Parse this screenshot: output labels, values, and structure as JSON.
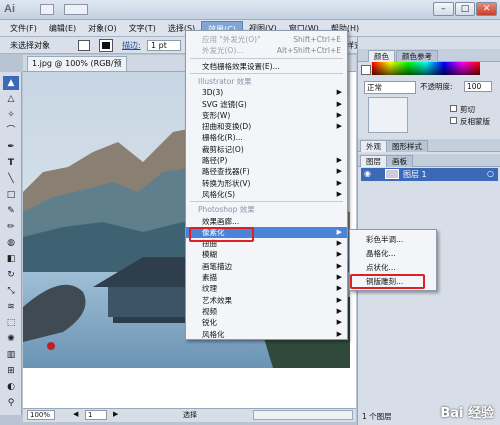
{
  "app": {
    "logo": "Ai",
    "window_controls": {
      "min": "–",
      "max": "□",
      "close": "✕"
    }
  },
  "menubar": {
    "items": [
      "文件(F)",
      "编辑(E)",
      "对象(O)",
      "文字(T)",
      "选择(S)",
      "效果(C)",
      "视图(V)",
      "窗口(W)",
      "帮助(H)"
    ],
    "active_index": 5
  },
  "control_bar": {
    "selection_label": "未选择对象",
    "stroke_label": "描边:",
    "stroke_value": "1 pt",
    "style_label": "样式"
  },
  "document": {
    "tab_title": "1.jpg @ 100% (RGB/预览)",
    "zoom": "100%",
    "page": "1",
    "status": "选择"
  },
  "effects_menu": {
    "items": [
      {
        "label": "应用 \"外发光(O)\"",
        "shortcut": "Shift+Ctrl+E",
        "disabled": true
      },
      {
        "label": "外发光(O)...",
        "shortcut": "Alt+Shift+Ctrl+E",
        "disabled": true
      },
      {
        "label": "文档栅格效果设置(E)...",
        "shortcut": ""
      },
      {
        "label": "Illustrator 效果",
        "header": true
      },
      {
        "label": "3D(3)",
        "submenu": true
      },
      {
        "label": "SVG 滤镜(G)",
        "submenu": true
      },
      {
        "label": "变形(W)",
        "submenu": true
      },
      {
        "label": "扭曲和变换(D)",
        "submenu": true
      },
      {
        "label": "栅格化(R)...",
        "submenu": false
      },
      {
        "label": "裁剪标记(O)",
        "submenu": false
      },
      {
        "label": "路径(P)",
        "submenu": true
      },
      {
        "label": "路径查找器(F)",
        "submenu": true
      },
      {
        "label": "转换为形状(V)",
        "submenu": true
      },
      {
        "label": "风格化(S)",
        "submenu": true
      },
      {
        "label": "Photoshop 效果",
        "header": true
      },
      {
        "label": "效果画廊...",
        "submenu": false
      },
      {
        "label": "像素化",
        "submenu": true,
        "highlighted": true
      },
      {
        "label": "扭曲",
        "submenu": true
      },
      {
        "label": "模糊",
        "submenu": true
      },
      {
        "label": "画笔描边",
        "submenu": true
      },
      {
        "label": "素描",
        "submenu": true
      },
      {
        "label": "纹理",
        "submenu": true
      },
      {
        "label": "艺术效果",
        "submenu": true
      },
      {
        "label": "视频",
        "submenu": true
      },
      {
        "label": "锐化",
        "submenu": true
      },
      {
        "label": "风格化",
        "submenu": true
      }
    ]
  },
  "pixelate_submenu": {
    "items": [
      "彩色半调...",
      "晶格化...",
      "点状化...",
      "铜版雕刻..."
    ],
    "highlighted_index": 3
  },
  "color_panel": {
    "tabs": [
      "颜色",
      "颜色参考"
    ]
  },
  "transparency_panel": {
    "mode": "正常",
    "opacity_label": "不透明度:",
    "opacity_value": "100",
    "cut_label": "剪切",
    "invert_label": "反相蒙版"
  },
  "appearance_panel": {
    "tabs": [
      "外观",
      "图形样式"
    ]
  },
  "layers_panel": {
    "tabs": [
      "图层",
      "画板"
    ],
    "layer_name": "图层 1",
    "layer_count": "1 个图层"
  },
  "watermark": "Bai 经验",
  "colors": {
    "accent": "#4b84d6",
    "highlight_box": "#e02020",
    "menu_active": "#7fa6d6"
  }
}
